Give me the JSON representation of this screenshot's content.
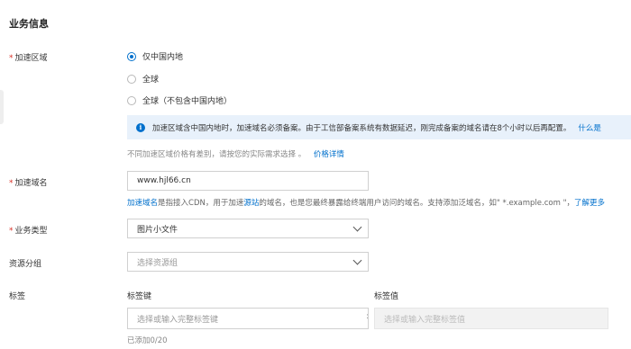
{
  "section_title": "业务信息",
  "accel_region": {
    "label": "加速区域",
    "required_mark": "*",
    "options": [
      "仅中国内地",
      "全球",
      "全球（不包含中国内地）"
    ],
    "selected_index": 0,
    "notice_icon": "info-icon",
    "notice_text": "加速区域含中国内地时，加速域名必须备案。由于工信部备案系统有数据延迟，刚完成备案的域名请在8个小时以后再配置。",
    "notice_link": "什么是",
    "price_hint": "不同加速区域价格有差别，请按您的实际需求选择 。",
    "price_link": "价格详情"
  },
  "domain": {
    "label": "加速域名",
    "required_mark": "*",
    "value": "www.hjl66.cn",
    "help_link1": "加速域名",
    "help_text1": "是指接入CDN，用于加速",
    "help_link2": "源站",
    "help_text2": "的域名，也是您最终暴露给终端用户访问的域名。支持添加泛域名，如\" *.example.com \"，",
    "help_link3": "了解更多"
  },
  "business_type": {
    "label": "业务类型",
    "required_mark": "*",
    "value": "图片小文件",
    "icon": "chevron-down-icon"
  },
  "resource_group": {
    "label": "资源分组",
    "placeholder": "选择资源组",
    "icon": "chevron-down-icon"
  },
  "tags": {
    "label": "标签",
    "key_header": "标签键",
    "value_header": "标签值",
    "key_placeholder": "选择或输入完整标签键",
    "separator": ":",
    "value_placeholder": "选择或输入完整标签值",
    "count_text": "已添加0/20"
  },
  "colors": {
    "accent": "#0070cc",
    "required": "#d93026",
    "notice_bg": "#e8f1fb"
  }
}
